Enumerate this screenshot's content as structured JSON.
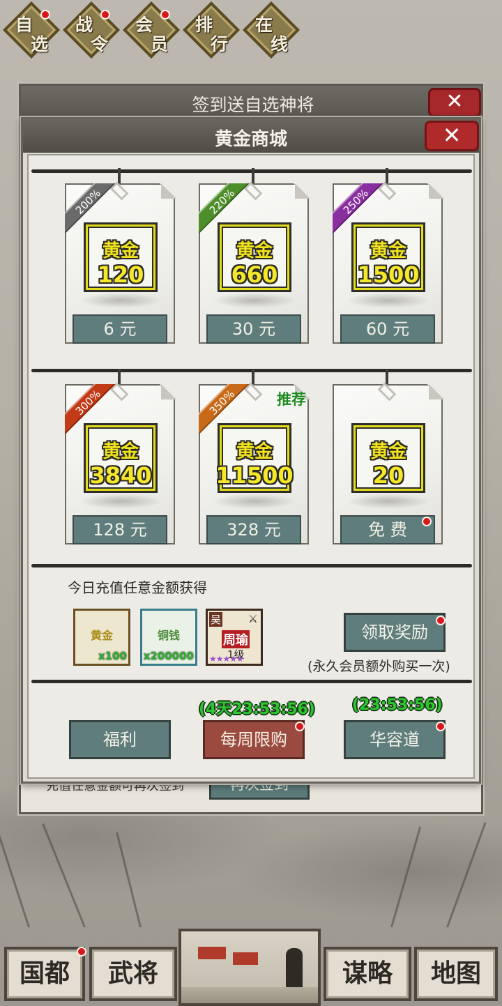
{
  "top_menu": [
    {
      "c1": "自",
      "c2": "选",
      "badge": true
    },
    {
      "c1": "战",
      "c2": "令",
      "badge": true
    },
    {
      "c1": "会",
      "c2": "员",
      "badge": true
    },
    {
      "c1": "排",
      "c2": "行",
      "badge": false
    },
    {
      "c1": "在",
      "c2": "线",
      "badge": false
    }
  ],
  "under_dialog": {
    "title": "签到送自选神将",
    "close": "✕",
    "note": "充值任意金额可再次签到",
    "button": "再次签到"
  },
  "dialog": {
    "title": "黄金商城",
    "close": "✕",
    "cards": [
      {
        "bonus": "200%",
        "label": "黄金",
        "amount": "120",
        "price": "6 元",
        "ribbon_color": "#6a6a6a"
      },
      {
        "bonus": "220%",
        "label": "黄金",
        "amount": "660",
        "price": "30 元",
        "ribbon_color": "#4e8f2b"
      },
      {
        "bonus": "250%",
        "label": "黄金",
        "amount": "1500",
        "price": "60 元",
        "ribbon_color": "#8a2fa0"
      },
      {
        "bonus": "300%",
        "label": "黄金",
        "amount": "3840",
        "price": "128 元",
        "ribbon_color": "#c23a16"
      },
      {
        "bonus": "350%",
        "label": "黄金",
        "amount": "11500",
        "price": "328 元",
        "ribbon_color": "#c96a18",
        "tag": "推荐"
      },
      {
        "bonus": "",
        "label": "黄金",
        "amount": "20",
        "price": "免 费",
        "badge": true
      }
    ],
    "daily": {
      "label": "今日充值任意金额获得",
      "rewards": [
        {
          "name": "黄金",
          "qty": "x100"
        },
        {
          "name": "铜钱",
          "qty": "x200000"
        },
        {
          "faction": "吴",
          "name": "周瑜",
          "level": "1级",
          "stars": "★★★★★"
        }
      ],
      "claim_button": "领取奖励",
      "vip_note": "(永久会员额外购买一次)"
    },
    "bottom_buttons": {
      "welfare": "福利",
      "weekly": "每周限购",
      "weekly_timer": "(4天23:53:56)",
      "huarong": "华容道",
      "huarong_timer": "(23:53:56)"
    }
  },
  "bottom_nav": {
    "capital": "国都",
    "generals": "武将",
    "strategy": "谋略",
    "map": "地图"
  },
  "colors": {
    "accent_gold": "#f5e82a",
    "button_slate": "#5e7d7c",
    "button_red": "#9a4a3e",
    "badge_red": "#d7181c",
    "timer_green": "#2fc72f"
  }
}
